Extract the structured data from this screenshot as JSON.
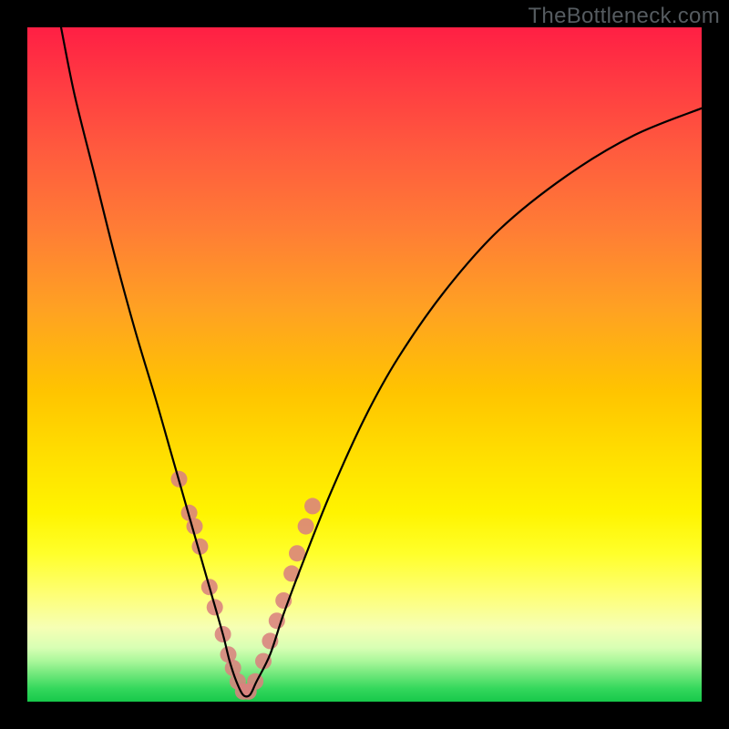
{
  "watermark": "TheBottleneck.com",
  "chart_data": {
    "type": "line",
    "title": "",
    "xlabel": "",
    "ylabel": "",
    "xlim": [
      0,
      100
    ],
    "ylim": [
      0,
      100
    ],
    "grid": false,
    "annotations": [],
    "series": [
      {
        "name": "bottleneck-curve",
        "color": "#000000",
        "x": [
          5,
          7,
          10,
          13,
          16,
          19,
          21,
          23,
          25,
          27,
          29,
          30,
          31,
          32,
          33,
          34,
          36,
          38,
          41,
          45,
          50,
          55,
          62,
          70,
          80,
          90,
          100
        ],
        "y": [
          100,
          90,
          78,
          66,
          55,
          45,
          38,
          31,
          24,
          17,
          10,
          6,
          3,
          1,
          1,
          3,
          7,
          13,
          21,
          31,
          42,
          51,
          61,
          70,
          78,
          84,
          88
        ]
      }
    ],
    "markers": {
      "name": "highlight-dots",
      "color": "#d9827e",
      "radius_px": 9,
      "x": [
        22.5,
        24,
        24.8,
        25.6,
        27,
        27.8,
        29,
        29.8,
        30.5,
        31.2,
        32,
        32.8,
        33.8,
        35,
        36,
        37,
        38,
        39.2,
        40,
        41.3,
        42.3
      ],
      "y": [
        33,
        28,
        26,
        23,
        17,
        14,
        10,
        7,
        5,
        3,
        1.5,
        1.5,
        3,
        6,
        9,
        12,
        15,
        19,
        22,
        26,
        29
      ]
    }
  }
}
